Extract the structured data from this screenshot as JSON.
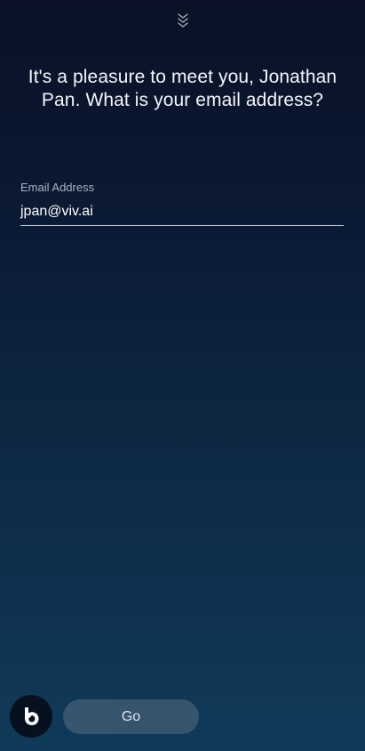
{
  "header": {
    "collapse_icon": "chevron-double-down-icon"
  },
  "prompt": {
    "text": "It's a pleasure to meet you, Jonathan Pan. What is your email address?"
  },
  "email_field": {
    "label": "Email Address",
    "value": "jpan@viv.ai"
  },
  "footer": {
    "assistant_icon": "bixby-icon",
    "go_label": "Go"
  },
  "colors": {
    "background_top": "#0a1126",
    "background_bottom": "#103a5a",
    "go_button": "#3a5670",
    "assistant_button": "#06101f"
  }
}
